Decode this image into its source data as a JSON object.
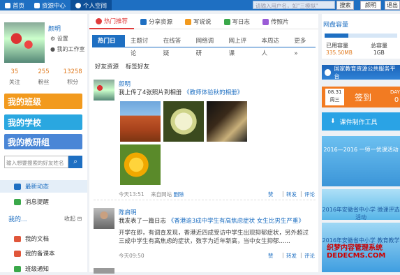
{
  "topbar": {
    "nav": [
      {
        "label": "首页",
        "active": false
      },
      {
        "label": "资源中心",
        "active": false
      },
      {
        "label": "个人空间",
        "active": true
      }
    ],
    "search_placeholder": "请输入用户名，如\"三模拟\"",
    "search_button": "搜索",
    "user_label": "颜明",
    "exit_label": "退出"
  },
  "profile": {
    "name": "颜明",
    "links": [
      "设置",
      "我的工作室"
    ],
    "stats": [
      {
        "value": "35",
        "label": "关注"
      },
      {
        "value": "255",
        "label": "粉丝"
      },
      {
        "value": "13258",
        "label": "积分"
      }
    ]
  },
  "quick_buttons": [
    "我的班级",
    "我的学校",
    "我的教研组"
  ],
  "friend_search_placeholder": "输入想要搜索的好友姓名",
  "left_menu": [
    {
      "label": "最新动态",
      "active": true
    },
    {
      "label": "消息提醒",
      "active": false
    }
  ],
  "my_section": {
    "title": "我的...",
    "fold_label": "收起"
  },
  "my_menu": [
    "我的文档",
    "我的备课本",
    "班级通知"
  ],
  "main_tabs": [
    "热门推荐",
    "分享资源",
    "写说说",
    "写日志",
    "传照片"
  ],
  "sub_tabs": [
    "热门日志",
    "主题讨论",
    "在线答疑",
    "网络调研",
    "网上评课",
    "本周达人",
    "更多"
  ],
  "sub_links": [
    "好友资源",
    "标签好友"
  ],
  "feeds": [
    {
      "name": "颜明",
      "text": "我上传了4张照片到相册",
      "link": "《教师体验秋的相册》",
      "time": "今天13:51",
      "source": "来自网站",
      "delete": "删除",
      "actions": [
        "赞",
        "转发",
        "评论"
      ]
    },
    {
      "name": "陈启明",
      "text": "我发表了一篇日志",
      "link": "《香港逾3成中学生有高焦虑症状 女生比男生严重》",
      "body": "开学在即，有调查发现，香港近四成受访中学生出现抑郁症状，另外超过三成中学生有高焦虑的症状，数字为近年新高，当中女生抑郁......",
      "time": "今天09:50",
      "actions": [
        "赞",
        "转发",
        "评论"
      ]
    }
  ],
  "right": {
    "cloud_title": "网盘容量",
    "used_label": "已用容量",
    "used_value": "335.50MB",
    "total_label": "总容量",
    "total_value": "1GB",
    "used_fraction": 0.33,
    "banner": "国家教育资源公共服务平台",
    "sign_date": "08.31",
    "sign_weekday": "周三",
    "sign_label": "签到",
    "sign_days_label": "DAYS",
    "sign_days": "0",
    "tool_label": "课件制作工具",
    "promo1": "2016—2016 一师一优课活动",
    "promo2": "2016年安徽省中小学 微课评选活动",
    "promo3": "2016年安徽省中小学 教育教学论文"
  },
  "watermark": "织梦内容管理系统 DEDECMS.COM"
}
